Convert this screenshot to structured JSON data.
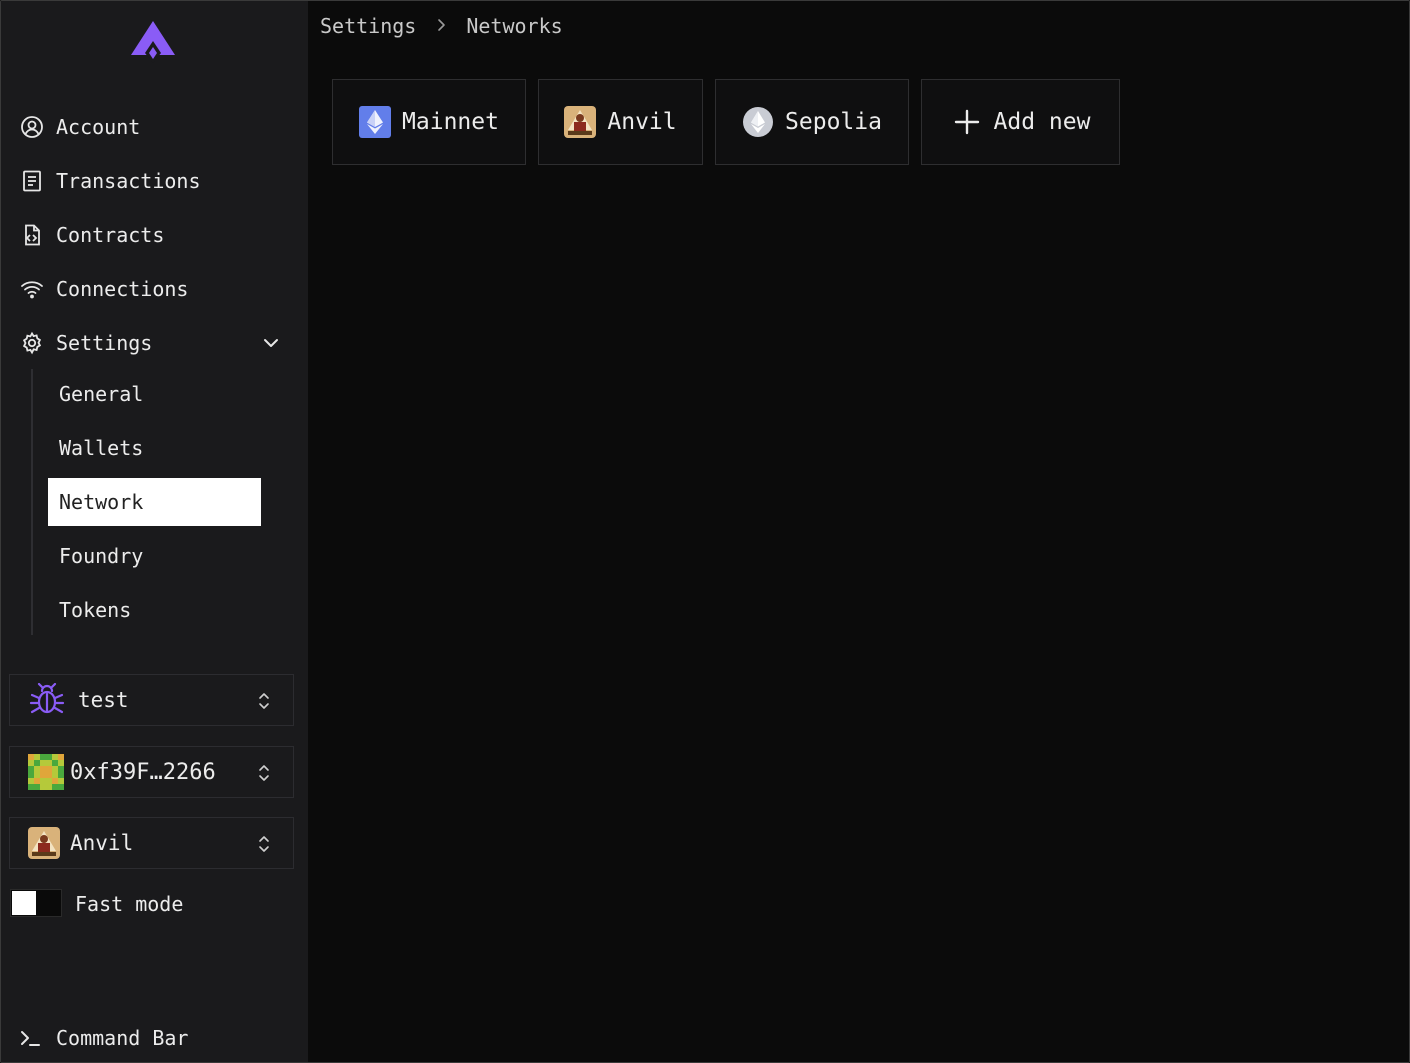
{
  "sidebar": {
    "nav": [
      {
        "label": "Account",
        "icon": "account-circle-icon"
      },
      {
        "label": "Transactions",
        "icon": "receipt-icon"
      },
      {
        "label": "Contracts",
        "icon": "code-file-icon"
      },
      {
        "label": "Connections",
        "icon": "wifi-icon"
      },
      {
        "label": "Settings",
        "icon": "gear-icon"
      }
    ],
    "settings_sub": [
      {
        "label": "General"
      },
      {
        "label": "Wallets"
      },
      {
        "label": "Network",
        "active": true
      },
      {
        "label": "Foundry"
      },
      {
        "label": "Tokens"
      }
    ],
    "wallet_select": {
      "label": "test",
      "icon": "bug-icon"
    },
    "account_select": {
      "label": "0xf39F…2266",
      "icon": "identicon-avatar"
    },
    "network_select": {
      "label": "Anvil",
      "icon": "anvil-network-icon"
    },
    "fast_mode": {
      "label": "Fast mode",
      "enabled": false
    },
    "command_bar": {
      "label": "Command Bar",
      "icon": "terminal-prompt-icon"
    }
  },
  "breadcrumb": {
    "items": [
      "Settings",
      "Networks"
    ]
  },
  "networks": [
    {
      "label": "Mainnet",
      "icon": "ethereum-blue-icon"
    },
    {
      "label": "Anvil",
      "icon": "anvil-network-icon"
    },
    {
      "label": "Sepolia",
      "icon": "ethereum-gray-icon"
    }
  ],
  "add_new": {
    "label": "Add new",
    "icon": "plus-icon"
  },
  "colors": {
    "brand": "#8a5cf6",
    "sidebar_bg": "#1a1a1c",
    "main_bg": "#0b0b0b",
    "active_bg": "#ffffff",
    "ethereum_blue": "#627eea"
  }
}
